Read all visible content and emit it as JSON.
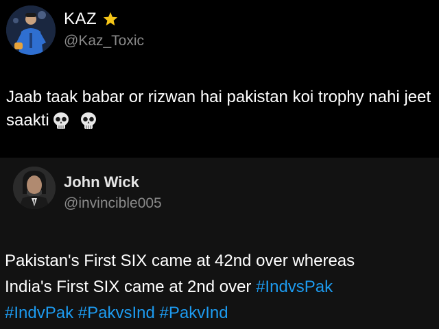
{
  "tweet": {
    "display_name": "KAZ",
    "badge_icon": "star-icon",
    "handle": "@Kaz_Toxic",
    "text": "Jaab taak babar or rizwan hai pakistan koi trophy nahi jeet saakti",
    "emoji_icons": [
      "skull-icon",
      "skull-icon"
    ]
  },
  "quoted_tweet": {
    "display_name": "John Wick",
    "handle": "@invincible005",
    "text_line_1": "Pakistan's First SIX came at 42nd over whereas",
    "text_line_2": "India's First SIX came at 2nd over ",
    "hashtags": [
      "#IndvsPak",
      "#IndvPak",
      "#PakvsInd",
      "#PakvInd"
    ]
  },
  "colors": {
    "background": "#000000",
    "quote_background": "#121212",
    "handle_gray": "#8a8a8a",
    "hashtag_blue": "#1d9bf0",
    "star_yellow": "#f5c518"
  }
}
